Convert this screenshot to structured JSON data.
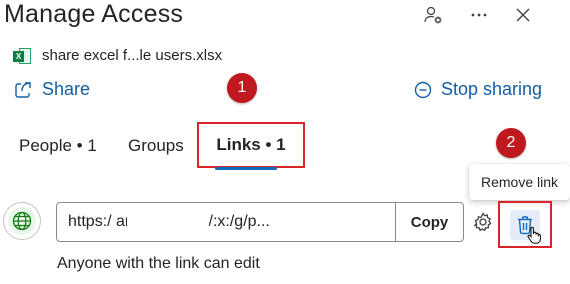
{
  "header": {
    "title": "Manage Access",
    "icons": [
      "person-settings-icon",
      "more-icon",
      "close-icon"
    ]
  },
  "file": {
    "name": "share excel f...le users.xlsx",
    "icon": "excel-file-icon",
    "badge": "X"
  },
  "actions": {
    "share_label": "Share",
    "stop_sharing_label": "Stop sharing"
  },
  "tabs": [
    {
      "label": "People • 1"
    },
    {
      "label": "Groups"
    },
    {
      "label": "Links • 1",
      "selected": true
    }
  ],
  "annotations": {
    "marker1": "1",
    "marker2": "2",
    "marker_color": "#c0181f",
    "highlight_color": "#d8262b"
  },
  "tooltip": "Remove link",
  "link": {
    "url": "https:/                          arepoint.com/:x:/g/p...",
    "copy_label": "Copy",
    "permission": "Anyone with the link can edit"
  },
  "colors": {
    "accent": "#115ea3",
    "tab_underline": "#0f6cbd",
    "globe_green": "#107c10"
  }
}
